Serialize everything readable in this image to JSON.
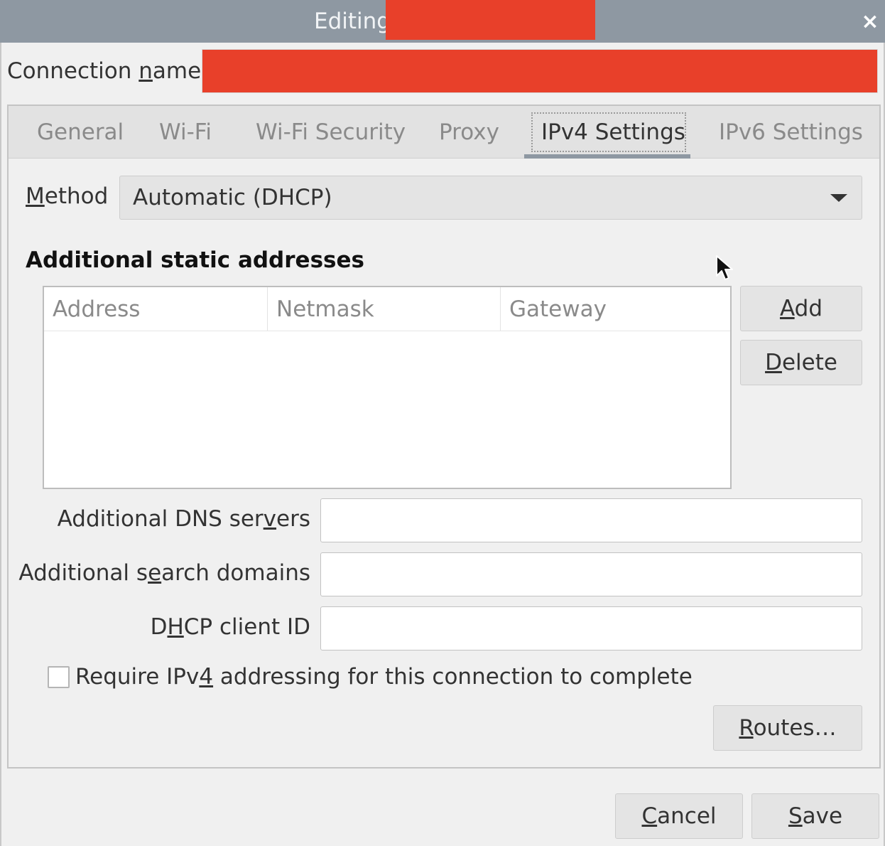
{
  "window": {
    "title": "Editing",
    "close_glyph": "×",
    "accent_color": "#8e98a2",
    "redaction_color": "#e8402a"
  },
  "connection": {
    "name_label_pre": "Connection ",
    "name_label_mn": "n",
    "name_label_post": "ame",
    "name_value": ""
  },
  "tabs": [
    {
      "label": "General"
    },
    {
      "label": "Wi-Fi"
    },
    {
      "label": "Wi-Fi Security"
    },
    {
      "label": "Proxy"
    },
    {
      "label": "IPv4 Settings",
      "active": true
    },
    {
      "label": "IPv6 Settings"
    }
  ],
  "ipv4": {
    "method_label_mn": "M",
    "method_label_post": "ethod",
    "method_value": "Automatic (DHCP)",
    "static_title": "Additional static addresses",
    "columns": [
      "Address",
      "Netmask",
      "Gateway"
    ],
    "rows": [],
    "add_mn": "A",
    "add_post": "dd",
    "delete_mn": "D",
    "delete_post": "elete",
    "dns_pre": "Additional DNS ser",
    "dns_mn": "v",
    "dns_post": "ers",
    "dns_value": "",
    "search_pre": "Additional s",
    "search_mn": "e",
    "search_post": "arch domains",
    "search_value": "",
    "dhcp_pre": "D",
    "dhcp_mn": "H",
    "dhcp_post": "CP client ID",
    "dhcp_value": "",
    "require_pre": "Require IPv",
    "require_mn": "4",
    "require_post": " addressing for this connection to complete",
    "require_checked": false,
    "routes_mn": "R",
    "routes_post": "outes…"
  },
  "footer": {
    "cancel_mn": "C",
    "cancel_post": "ancel",
    "save_mn": "S",
    "save_post": "ave"
  },
  "icons": [
    "close-icon",
    "chevron-down-icon",
    "pointer-icon"
  ]
}
